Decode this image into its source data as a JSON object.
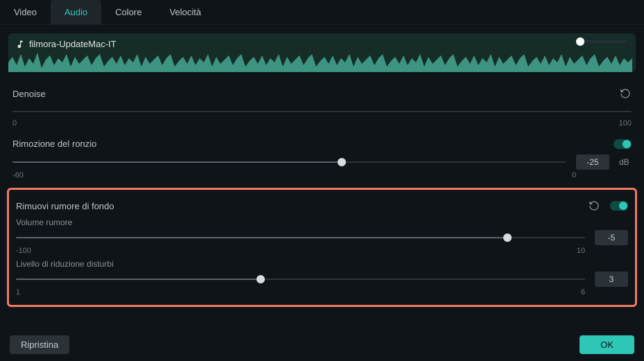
{
  "tabs": {
    "video": "Video",
    "audio": "Audio",
    "color": "Colore",
    "speed": "Velocità"
  },
  "clip": {
    "name": "filmora-UpdateMac-IT"
  },
  "denoise": {
    "title": "Denoise",
    "min": "0",
    "max": "100"
  },
  "hum": {
    "title": "Rimozione del ronzio",
    "min": "-60",
    "max": "0",
    "value": "-25",
    "unit": "dB",
    "fill_pct": 59.5
  },
  "bgnoise": {
    "title": "Rimuovi rumore di fondo",
    "vol_label": "Volume rumore",
    "vol_min": "-100",
    "vol_max": "10",
    "vol_value": "-5",
    "vol_fill_pct": 86.4,
    "lvl_label": "Livello di riduzione disturbi",
    "lvl_min": "1",
    "lvl_max": "6",
    "lvl_value": "3",
    "lvl_fill_pct": 43
  },
  "footer": {
    "reset": "Ripristina",
    "ok": "OK"
  }
}
